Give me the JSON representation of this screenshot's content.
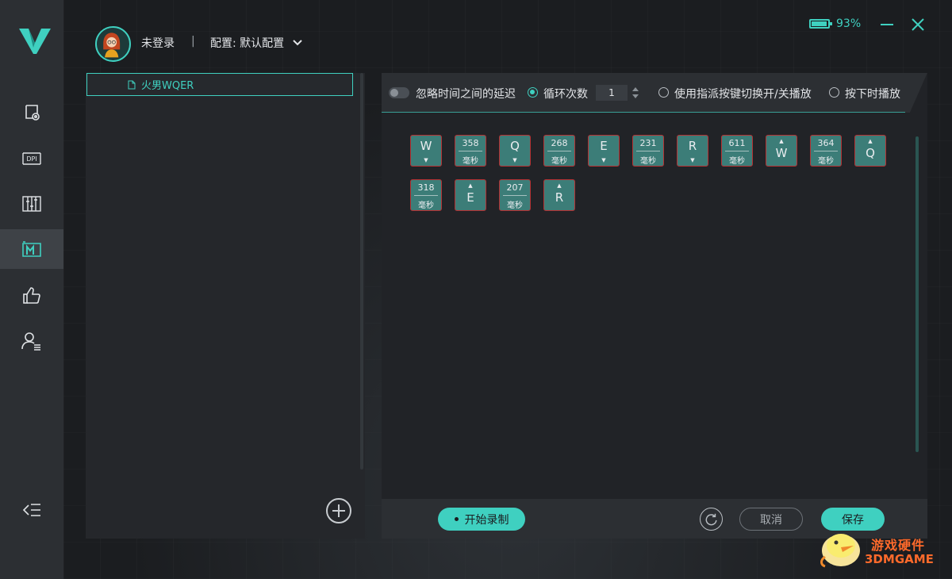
{
  "header": {
    "login_status": "未登录",
    "separator": "|",
    "config_label": "配置: 默认配置",
    "battery_percent": "93%",
    "battery_level": 0.93
  },
  "sidebar": {
    "items": [
      {
        "icon": "device-settings-icon",
        "active": false
      },
      {
        "icon": "dpi-icon",
        "active": false
      },
      {
        "icon": "equalizer-icon",
        "active": false
      },
      {
        "icon": "macro-icon",
        "active": true
      },
      {
        "icon": "thumbs-up-icon",
        "active": false
      },
      {
        "icon": "user-list-icon",
        "active": false
      }
    ],
    "collapse_icon": "collapse-menu-icon"
  },
  "macro_list": {
    "items": [
      {
        "label": "火男WQER",
        "selected": true
      }
    ]
  },
  "toolbar": {
    "ignore_delay_label": "忽略时间之间的延迟",
    "loop_count_label": "循环次数",
    "loop_count_value": "1",
    "toggle_play_label": "使用指派按键切换开/关播放",
    "hold_play_label": "按下时播放",
    "selected_mode": "loop_count"
  },
  "macro_events": [
    {
      "type": "key",
      "key": "W",
      "action": "down"
    },
    {
      "type": "delay",
      "value": "358",
      "unit": "毫秒"
    },
    {
      "type": "key",
      "key": "Q",
      "action": "down"
    },
    {
      "type": "delay",
      "value": "268",
      "unit": "毫秒"
    },
    {
      "type": "key",
      "key": "E",
      "action": "down"
    },
    {
      "type": "delay",
      "value": "231",
      "unit": "毫秒"
    },
    {
      "type": "key",
      "key": "R",
      "action": "down"
    },
    {
      "type": "delay",
      "value": "611",
      "unit": "毫秒"
    },
    {
      "type": "key",
      "key": "W",
      "action": "up"
    },
    {
      "type": "delay",
      "value": "364",
      "unit": "毫秒"
    },
    {
      "type": "key",
      "key": "Q",
      "action": "up"
    },
    {
      "type": "delay",
      "value": "318",
      "unit": "毫秒"
    },
    {
      "type": "key",
      "key": "E",
      "action": "up"
    },
    {
      "type": "delay",
      "value": "207",
      "unit": "毫秒"
    },
    {
      "type": "key",
      "key": "R",
      "action": "up"
    }
  ],
  "footer": {
    "record_label": "开始录制",
    "cancel_label": "取消",
    "save_label": "保存"
  },
  "watermark": {
    "line1": "游戏硬件",
    "line2": "3DMGAME"
  },
  "colors": {
    "accent": "#3fd0c0",
    "key_fill": "#3c7d78",
    "key_border": "#b53133",
    "panel": "#25272b",
    "rail": "#2c2f33"
  }
}
